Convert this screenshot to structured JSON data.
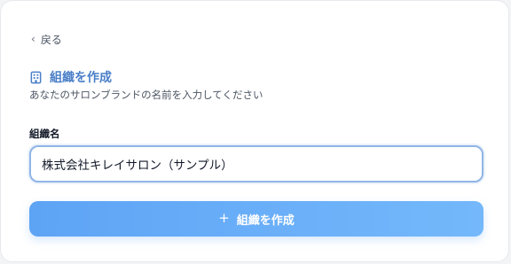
{
  "back": {
    "label": "戻る"
  },
  "header": {
    "icon": "building-icon",
    "title": "組織を作成",
    "subtitle": "あなたのサロンブランドの名前を入力してください"
  },
  "form": {
    "org_name_label": "組織名",
    "org_name_value": "株式会社キレイサロン（サンプル）",
    "submit_label": "組織を作成",
    "submit_icon": "plus-icon"
  },
  "colors": {
    "accent": "#4a7fc8",
    "button_start": "#5ea4f5",
    "button_end": "#74b8fb",
    "input_border": "#8fb5e6"
  }
}
